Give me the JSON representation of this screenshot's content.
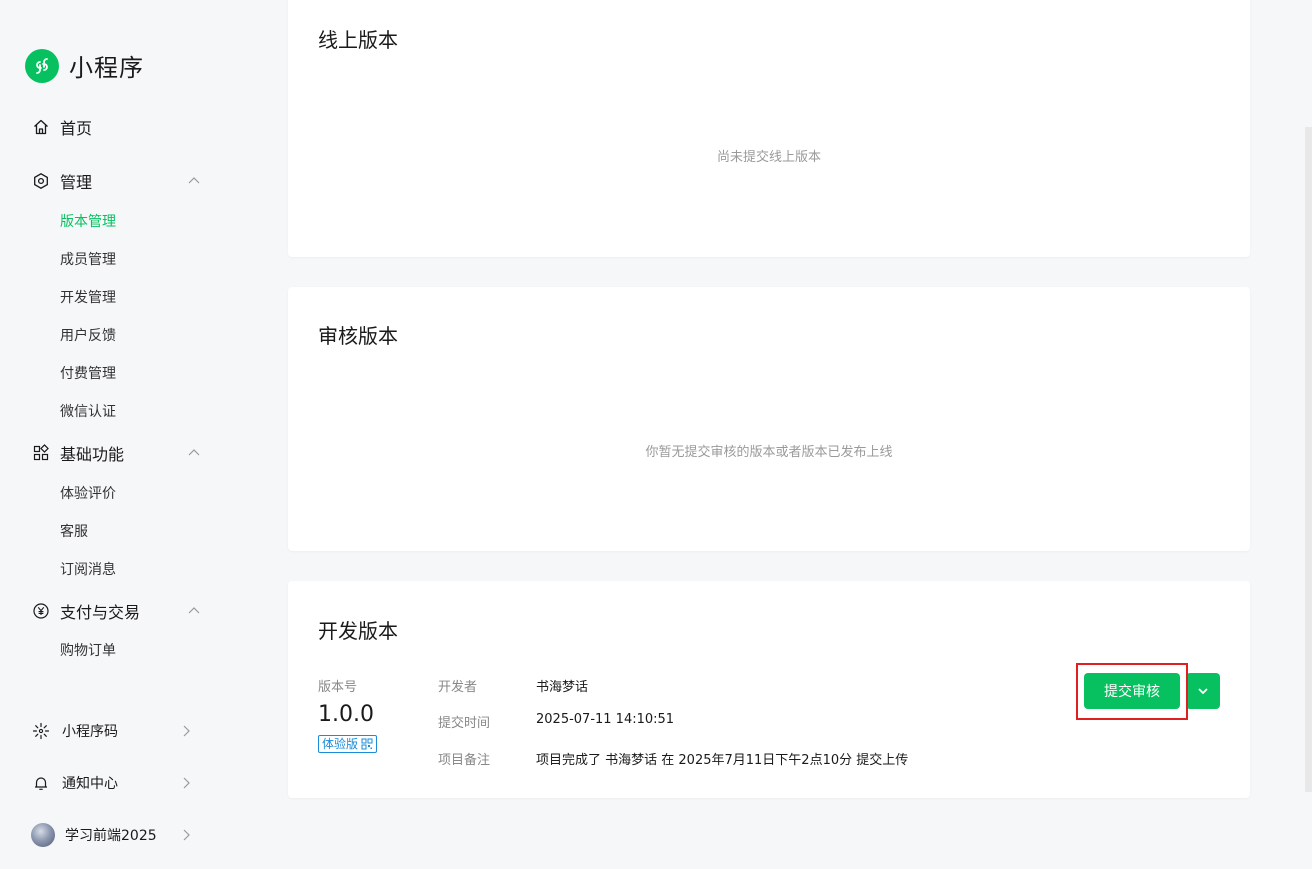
{
  "app": {
    "title": "小程序"
  },
  "sidebar": {
    "home": "首页",
    "manage": {
      "label": "管理",
      "items": [
        "版本管理",
        "成员管理",
        "开发管理",
        "用户反馈",
        "付费管理",
        "微信认证"
      ]
    },
    "basic": {
      "label": "基础功能",
      "items": [
        "体验评价",
        "客服",
        "订阅消息"
      ]
    },
    "payment": {
      "label": "支付与交易",
      "items": [
        "购物订单"
      ]
    },
    "bottom": {
      "qrcode": "小程序码",
      "notify": "通知中心",
      "account": "学习前端2025"
    },
    "active_item": "版本管理"
  },
  "online": {
    "title": "线上版本",
    "empty": "尚未提交线上版本"
  },
  "review": {
    "title": "审核版本",
    "empty": "你暂无提交审核的版本或者版本已发布上线"
  },
  "dev": {
    "title": "开发版本",
    "version_label": "版本号",
    "version": "1.0.0",
    "tag": "体验版",
    "developer_label": "开发者",
    "developer": "书海梦话",
    "time_label": "提交时间",
    "time": "2025-07-11 14:10:51",
    "note_label": "项目备注",
    "note": "项目完成了 书海梦话 在 2025年7月11日下午2点10分 提交上传",
    "submit_button": "提交审核"
  },
  "colors": {
    "accent": "#07c160",
    "tag_blue": "#1a8cd8",
    "highlight": "#e02020"
  }
}
